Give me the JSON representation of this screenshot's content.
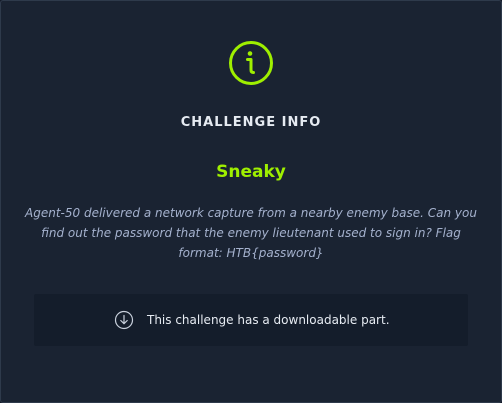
{
  "modal": {
    "icon": "info-circle-icon",
    "heading": "CHALLENGE INFO",
    "challenge_name": "Sneaky",
    "description": "Agent-50 delivered a network capture from a nearby enemy base. Can you find out the password that the enemy lieutenant used to sign in? Flag format: HTB{password}",
    "download": {
      "icon": "download-circle-icon",
      "text": "This challenge has a downloadable part."
    }
  },
  "colors": {
    "accent": "#9fef00",
    "background": "#1a2332",
    "panel": "#141d2b",
    "text": "#e6ebf2",
    "muted_text": "#a4b1cd"
  }
}
